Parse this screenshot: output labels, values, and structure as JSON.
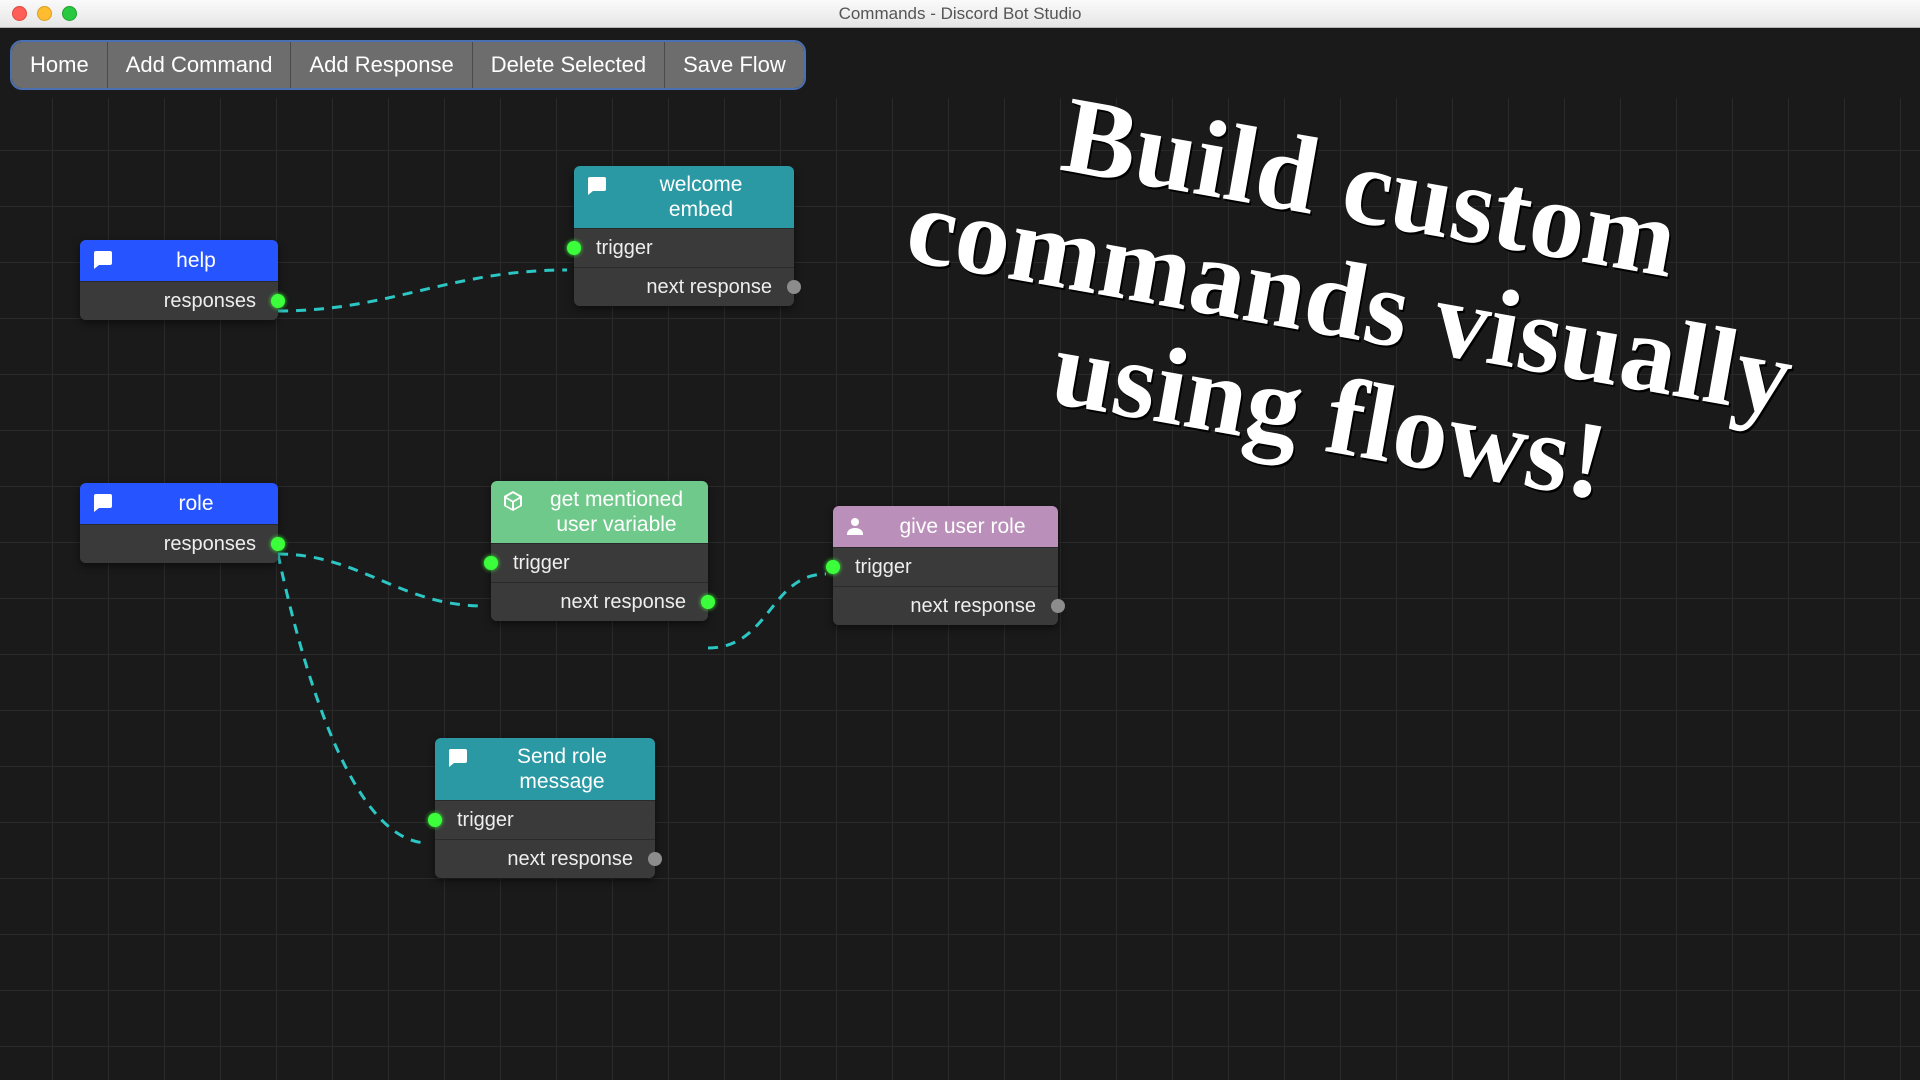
{
  "window": {
    "title": "Commands - Discord Bot Studio"
  },
  "toolbar": {
    "home": "Home",
    "add_command": "Add Command",
    "add_response": "Add Response",
    "delete_selected": "Delete Selected",
    "save_flow": "Save Flow"
  },
  "promo": "Build custom commands visually using flows!",
  "labels": {
    "trigger": "trigger",
    "next_response": "next response",
    "responses": "responses"
  },
  "nodes": {
    "help": {
      "title": "help"
    },
    "welcome_embed": {
      "title_l1": "welcome",
      "title_l2": "embed"
    },
    "role": {
      "title": "role"
    },
    "get_mentioned": {
      "title_l1": "get mentioned",
      "title_l2": "user variable"
    },
    "give_user_role": {
      "title": "give user role"
    },
    "send_role_msg": {
      "title_l1": "Send role",
      "title_l2": "message"
    }
  }
}
